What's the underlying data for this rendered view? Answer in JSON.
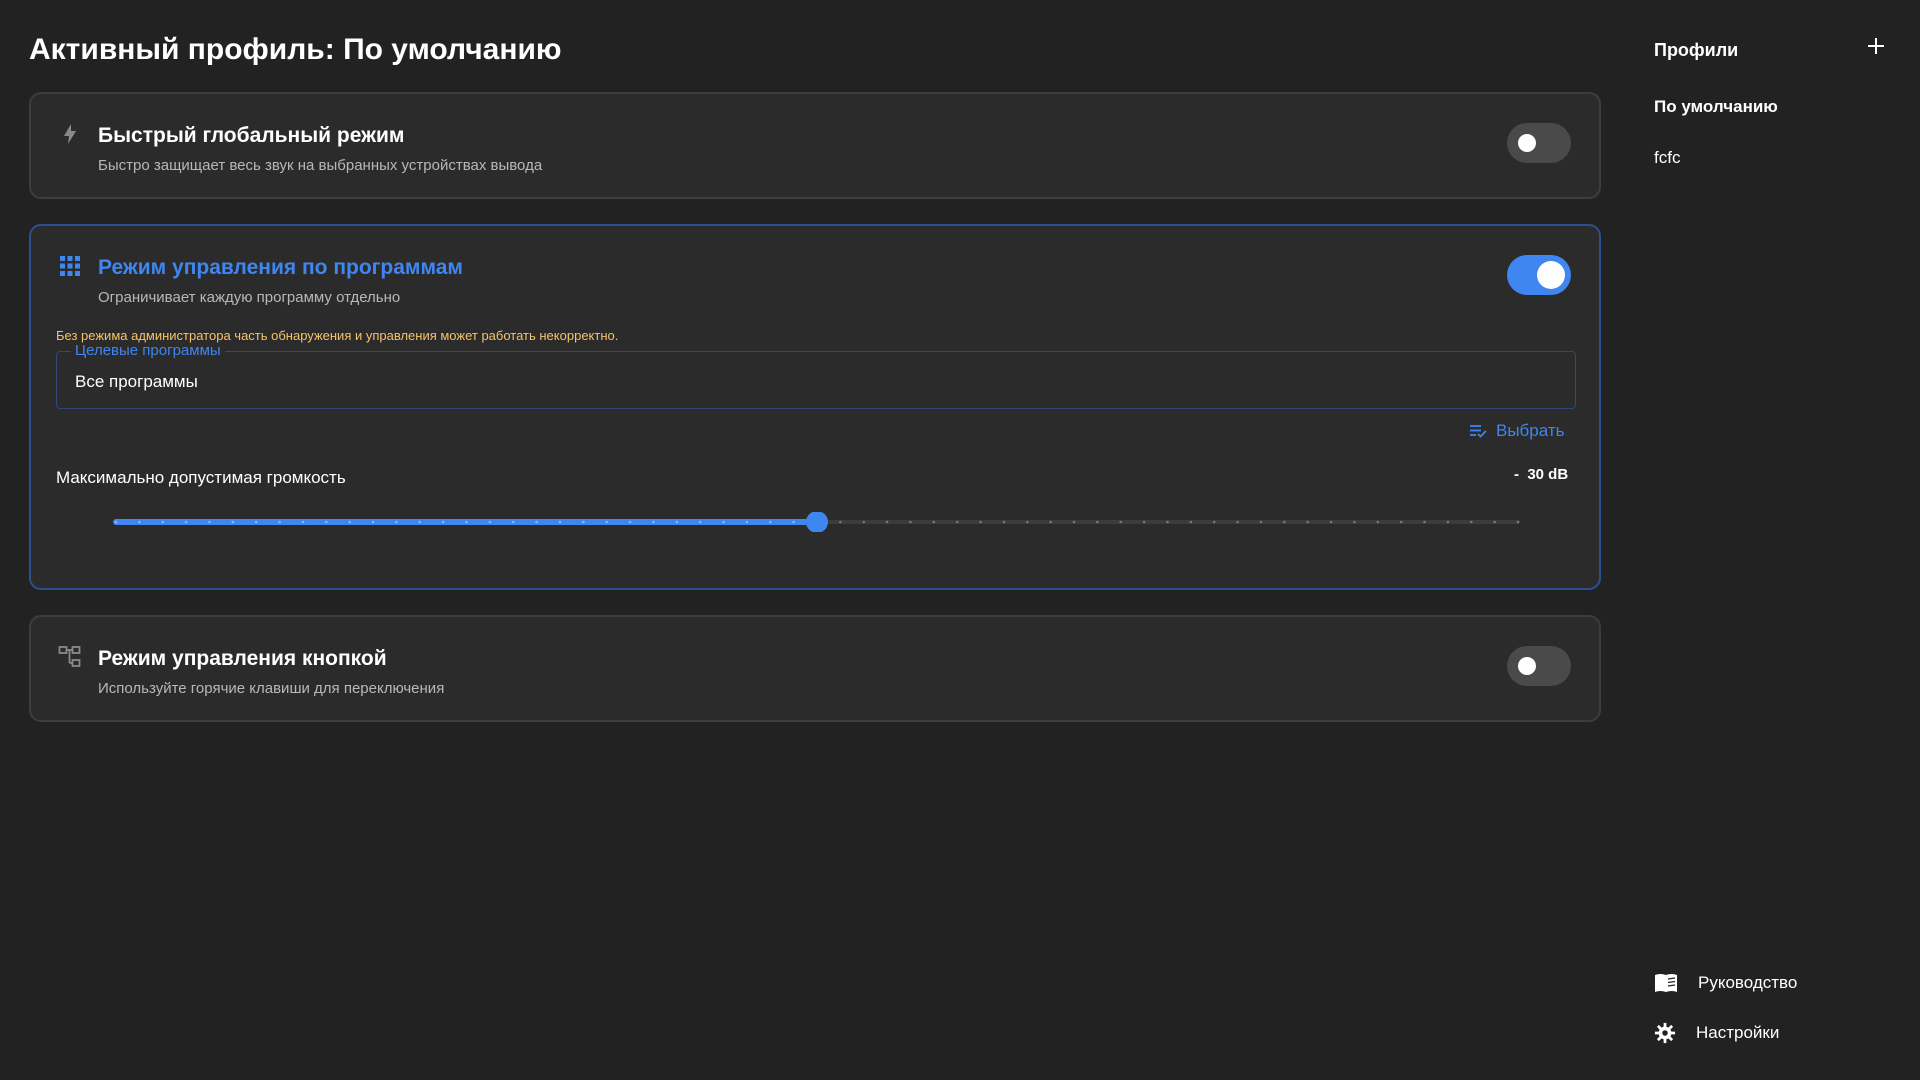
{
  "page": {
    "title": "Активный профиль: По умолчанию"
  },
  "modes": {
    "global": {
      "icon": "lightning-icon",
      "title": "Быстрый глобальный режим",
      "subtitle": "Быстро защищает весь звук на выбранных устройствах вывода",
      "enabled": false
    },
    "apps": {
      "icon": "grid-icon",
      "title": "Режим управления по программам",
      "subtitle": "Ограничивает каждую программу отдельно",
      "enabled": true,
      "warning": "Без режима администратора часть обнаружения и управления может работать некорректно.",
      "target_label": "Целевые программы",
      "target_value": "Все программы",
      "choose_label": "Выбрать",
      "volume_label": "Максимально допустимая громкость",
      "volume_value": "-  30 dB",
      "volume_level_fraction": 0.5
    },
    "button": {
      "icon": "hotkey-diagram-icon",
      "title": "Режим управления кнопкой",
      "subtitle": "Используйте горячие клавиши для переключения",
      "enabled": false
    }
  },
  "sidebar": {
    "title": "Профили",
    "add_icon": "plus-icon",
    "profiles": [
      {
        "name": "По умолчанию",
        "active": true
      },
      {
        "name": "fcfc",
        "active": false
      }
    ],
    "footer": {
      "guide": {
        "icon": "book-icon",
        "label": "Руководство"
      },
      "settings": {
        "icon": "gear-icon",
        "label": "Настройки"
      }
    }
  },
  "colors": {
    "background": "#222222",
    "card": "#2b2b2b",
    "accent": "#3f86f0",
    "warning": "#f5c36b"
  }
}
